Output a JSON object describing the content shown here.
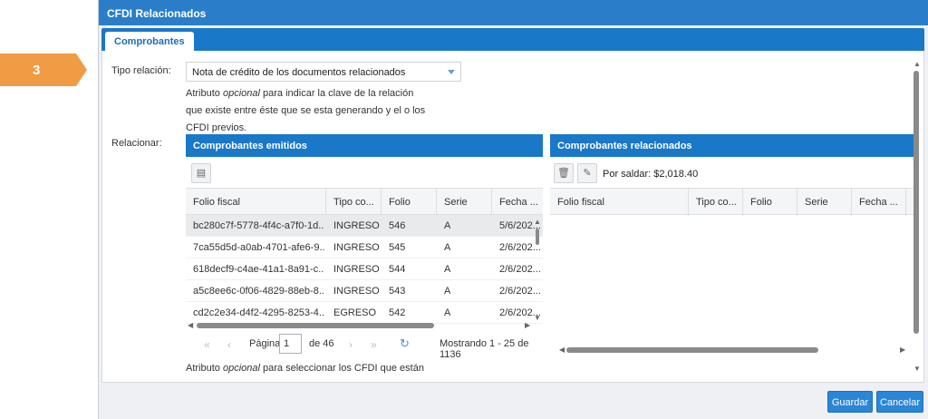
{
  "step": {
    "number": "3"
  },
  "window": {
    "title": "CFDI Relacionados"
  },
  "tabs": [
    {
      "label": "Comprobantes"
    }
  ],
  "form": {
    "tipo_relacion_label": "Tipo relación:",
    "tipo_relacion_value": "Nota de crédito de los documentos relacionados",
    "tipo_help_1": "Atributo ",
    "tipo_help_em": "opcional",
    "tipo_help_2": " para indicar la clave de la relación que existe entre éste que se esta generando y el o los CFDI previos.",
    "relacionar_label": "Relacionar:",
    "relacionar_help_1": "Atributo ",
    "relacionar_help_em": "opcional",
    "relacionar_help_2": " para seleccionar los CFDI que están"
  },
  "emitidos": {
    "title": "Comprobantes emitidos",
    "columns": [
      "Folio fiscal",
      "Tipo co...",
      "Folio",
      "Serie",
      "Fecha ..."
    ],
    "rows": [
      {
        "folio_fiscal": "bc280c7f-5778-4f4c-a7f0-1d...",
        "tipo": "INGRESO",
        "folio": "546",
        "serie": "A",
        "fecha": "5/6/202...",
        "selected": true
      },
      {
        "folio_fiscal": "7ca55d5d-a0ab-4701-afe6-9...",
        "tipo": "INGRESO",
        "folio": "545",
        "serie": "A",
        "fecha": "2/6/202..."
      },
      {
        "folio_fiscal": "618decf9-c4ae-41a1-8a91-c...",
        "tipo": "INGRESO",
        "folio": "544",
        "serie": "A",
        "fecha": "2/6/202..."
      },
      {
        "folio_fiscal": "a5c8ee6c-0f06-4829-88eb-8...",
        "tipo": "INGRESO",
        "folio": "543",
        "serie": "A",
        "fecha": "2/6/202..."
      },
      {
        "folio_fiscal": "cd2c2e34-d4f2-4295-8253-4...",
        "tipo": "EGRESO",
        "folio": "542",
        "serie": "A",
        "fecha": "2/6/202..."
      }
    ],
    "pager": {
      "page_label": "Página",
      "page_value": "1",
      "of_label": "de 46",
      "summary": "Mostrando 1 - 25 de 1136"
    }
  },
  "relacionados": {
    "title": "Comprobantes relacionados",
    "por_saldar": "Por saldar: $2,018.40",
    "columns": [
      "Folio fiscal",
      "Tipo co...",
      "Folio",
      "Serie",
      "Fecha ..."
    ]
  },
  "footer": {
    "save_label": "Guardar",
    "cancel_label": "Cancelar"
  },
  "colors": {
    "accent": "#1a78c9",
    "step_badge": "#ef9c45"
  },
  "icons": {
    "add": "add-document-icon",
    "delete": "trash-icon",
    "edit": "edit-icon",
    "first": "«",
    "prev": "‹",
    "next": "›",
    "last": "»",
    "refresh": "↻"
  }
}
